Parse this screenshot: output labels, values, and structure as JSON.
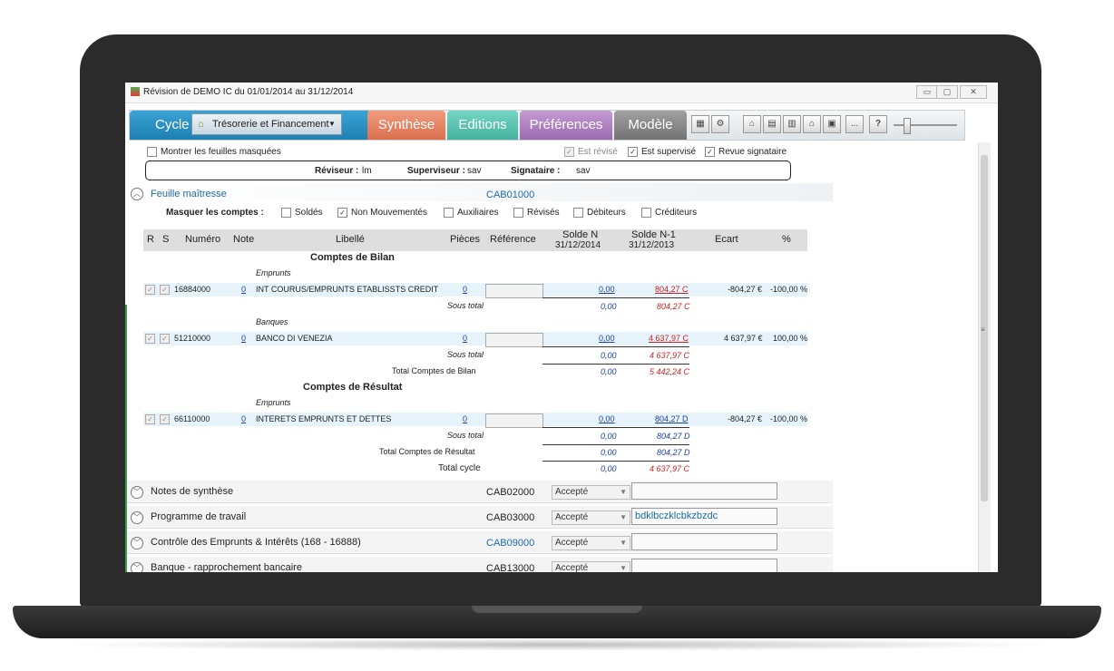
{
  "window": {
    "title": "Révision de DEMO IC du 01/01/2014 au 31/12/2014",
    "buttons": {
      "minimize": "▭",
      "maximize": "▢",
      "close": "✕"
    }
  },
  "toolbar": {
    "cycle_label": "Cycle",
    "cycle_select": "Trésorerie et Financement",
    "tabs": [
      "Synthèse",
      "Editions",
      "Préférences",
      "Modèle"
    ],
    "small_button": "...",
    "help_button": "?"
  },
  "colors": {
    "synthese": "#e8876a",
    "editions": "#5fc7b4",
    "preferences": "#b384c4",
    "modele": "#8b8b8b",
    "cycle": "#2c8fc4"
  },
  "options": {
    "show_hidden": "Montrer les feuilles masquées",
    "est_revise": "Est révisé",
    "est_supervise": "Est supervisé",
    "revue_signataire": "Revue signataire"
  },
  "people": {
    "reviseur_label": "Réviseur :",
    "reviseur": "lm",
    "superviseur_label": "Superviseur :",
    "superviseur": "sav",
    "signataire_label": "Signataire :",
    "signataire": "sav"
  },
  "master": {
    "title": "Feuille maîtresse",
    "code": "CAB01000",
    "mask_label": "Masquer les comptes :",
    "filters": [
      "Soldés",
      "Non Mouvementés",
      "Auxiliaires",
      "Révisés",
      "Débiteurs",
      "Créditeurs"
    ]
  },
  "table": {
    "headers": {
      "r": "R",
      "s": "S",
      "numero": "Numéro",
      "note": "Note",
      "libelle": "Libellé",
      "pieces": "Pièces",
      "reference": "Référence",
      "solde_n": "Solde N",
      "solde_n_date": "31/12/2014",
      "solde_n1": "Solde N-1",
      "solde_n1_date": "31/12/2013",
      "ecart": "Ecart",
      "pct": "%"
    },
    "bilan_title": "Comptes de Bilan",
    "resultat_title": "Comptes de Résultat",
    "groups": {
      "emprunts": "Emprunts",
      "banques": "Banques"
    },
    "rows": [
      {
        "numero": "16884000",
        "note": "0",
        "libelle": "INT COURUS/EMPRUNTS ETABLISSTS CREDIT",
        "pieces": "0",
        "solde_n": "0,00",
        "solde_n1": "804,27 C",
        "ecart": "-804,27 €",
        "pct": "-100,00 %"
      },
      {
        "numero": "51210000",
        "note": "0",
        "libelle": "BANCO DI VENEZIA",
        "pieces": "0",
        "solde_n": "0,00",
        "solde_n1": "4 637,97 C",
        "ecart": "4 637,97 €",
        "pct": "100,00 %"
      },
      {
        "numero": "66110000",
        "note": "0",
        "libelle": "INTERETS EMPRUNTS ET DETTES",
        "pieces": "0",
        "solde_n": "0,00",
        "solde_n1": "804,27 D",
        "ecart": "-804,27 €",
        "pct": "-100,00 %"
      }
    ],
    "totals": {
      "sous_total": "Sous total",
      "st1_n": "0,00",
      "st1_n1": "804,27 C",
      "st2_n": "0,00",
      "st2_n1": "4 637,97 C",
      "total_bilan_label": "Total Comptes de Bilan",
      "total_bilan_n": "0,00",
      "total_bilan_n1": "5 442,24 C",
      "st3_n": "0,00",
      "st3_n1": "804,27 D",
      "total_resultat_label": "Total Comptes de Résultat",
      "total_resultat_n": "0,00",
      "total_resultat_n1": "804,27 D",
      "total_cycle_label": "Total cycle",
      "total_cycle_n": "0,00",
      "total_cycle_n1": "4 637,97 C"
    }
  },
  "sections": [
    {
      "title": "Notes de synthèse",
      "code": "CAB02000",
      "status": "Accepté",
      "comment": ""
    },
    {
      "title": "Programme de travail",
      "code": "CAB03000",
      "status": "Accepté",
      "comment": "bdklbczklcbkzbzdc"
    },
    {
      "title": "Contrôle des Emprunts & Intérêts (168 - 16888)",
      "code": "CAB09000",
      "status": "Accepté",
      "comment": ""
    },
    {
      "title": "Banque - rapprochement bancaire",
      "code": "CAB13000",
      "status": "Accepté",
      "comment": ""
    }
  ]
}
